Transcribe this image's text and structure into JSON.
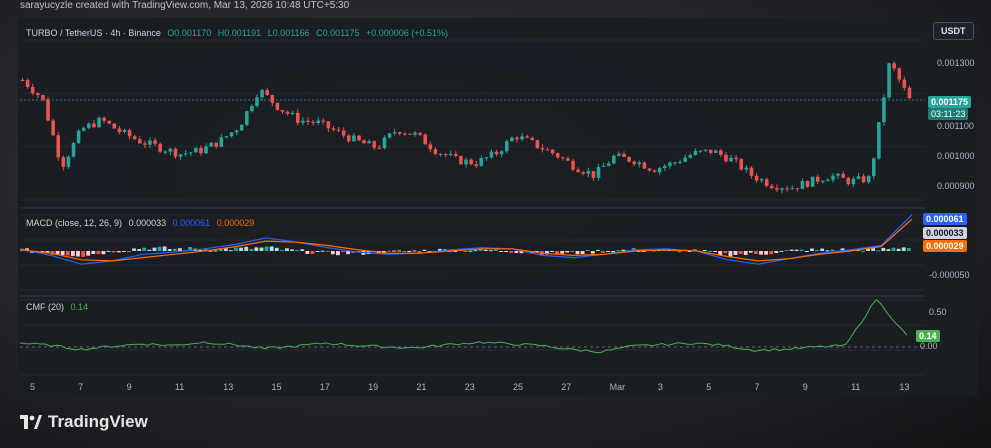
{
  "watermark": "sarayucyzle created with TradingView.com, Mar 13, 2026 10:48 UTC+5:30",
  "currency_button": "USDT",
  "main_legend": {
    "symbol": "TURBO / TetherUS · 4h · Binance",
    "open": "O0.001170",
    "high": "H0.001191",
    "low": "L0.001166",
    "close": "C0.001175",
    "change": "+0.000006 (+0.51%)"
  },
  "macd_legend": {
    "label": "MACD (close, 12, 26, 9)",
    "macd": "0.000033",
    "signal": "0.000061",
    "hist": "0.000029"
  },
  "cmf_legend": {
    "label": "CMF (20)",
    "value": "0.14"
  },
  "price_scale": [
    "0.001300",
    "0.001100",
    "0.001000",
    "0.000900"
  ],
  "last_price_tag": "0.001175",
  "countdown_tag": "03:11:23",
  "macd_tags": [
    "0.000061",
    "0.000033",
    "0.000029"
  ],
  "macd_scale": [
    "-0.000050"
  ],
  "cmf_scale": [
    "0.50",
    "0.00"
  ],
  "cmf_tag": "0.14",
  "x_axis": [
    "5",
    "7",
    "9",
    "11",
    "13",
    "15",
    "17",
    "19",
    "21",
    "23",
    "25",
    "27",
    "Mar",
    "3",
    "5",
    "7",
    "9",
    "11",
    "13"
  ],
  "brand": "TradingView",
  "colors": {
    "up": "#26a69a",
    "down": "#ef5350",
    "macd": "#2962ff",
    "signal": "#ff6d00",
    "cmf": "#4caf50"
  },
  "chart_data": {
    "type": "candlestick",
    "title": "TURBO / TetherUS · 4h · Binance",
    "x_ticks": [
      "5",
      "7",
      "9",
      "11",
      "13",
      "15",
      "17",
      "19",
      "21",
      "23",
      "25",
      "27",
      "Mar",
      "3",
      "5",
      "7",
      "9",
      "11",
      "13"
    ],
    "ylim": [
      0.00085,
      0.00137
    ],
    "close_path": [
      0.00124,
      0.00118,
      0.00096,
      0.00108,
      0.00111,
      0.00107,
      0.00104,
      0.00102,
      0.001,
      0.00101,
      0.00104,
      0.00109,
      0.00121,
      0.00115,
      0.00111,
      0.0011,
      0.00107,
      0.00104,
      0.00102,
      0.00108,
      0.00106,
      0.00101,
      0.00098,
      0.00097,
      0.001,
      0.00106,
      0.00103,
      0.001,
      0.00096,
      0.00093,
      0.00099,
      0.00098,
      0.00095,
      0.00097,
      0.001,
      0.00101,
      0.00098,
      0.00093,
      0.0009,
      0.00089,
      0.00091,
      0.00093,
      0.00091,
      0.00092,
      0.0013,
      0.001175
    ],
    "macd": [
      2e-06,
      -4e-06,
      -1.2e-05,
      -9e-06,
      -3e-06,
      -1e-06,
      2e-06,
      6e-06,
      1.2e-05,
      8e-06,
      3e-06,
      -1e-06,
      -3e-06,
      -2e-06,
      1e-06,
      3e-06,
      2e-06,
      -4e-06,
      -6e-06,
      -3e-06,
      1e-06,
      2e-06,
      0.0,
      -8e-06,
      -1.2e-05,
      -7e-06,
      -2e-06,
      1e-06,
      5e-06,
      3.3e-05
    ],
    "signal": [
      1e-06,
      -2e-06,
      -8e-06,
      -9e-06,
      -6e-06,
      -3e-06,
      0.0,
      4e-06,
      9e-06,
      8e-06,
      5e-06,
      1e-06,
      -2e-06,
      -2e-06,
      0.0,
      2e-06,
      2e-06,
      -2e-06,
      -4e-06,
      -3e-06,
      0.0,
      1e-06,
      0.0,
      -5e-06,
      -9e-06,
      -7e-06,
      -3e-06,
      0.0,
      4e-06,
      2.9e-05
    ],
    "cmf": [
      0.05,
      0.02,
      -0.03,
      0.01,
      0.04,
      0.02,
      0.06,
      0.03,
      -0.02,
      0.01,
      0.05,
      0.02,
      0.0,
      -0.01,
      0.03,
      0.06,
      0.04,
      0.02,
      -0.03,
      -0.06,
      0.01,
      0.03,
      0.05,
      0.02,
      -0.04,
      -0.03,
      0.0,
      0.02,
      0.6,
      0.14
    ]
  }
}
